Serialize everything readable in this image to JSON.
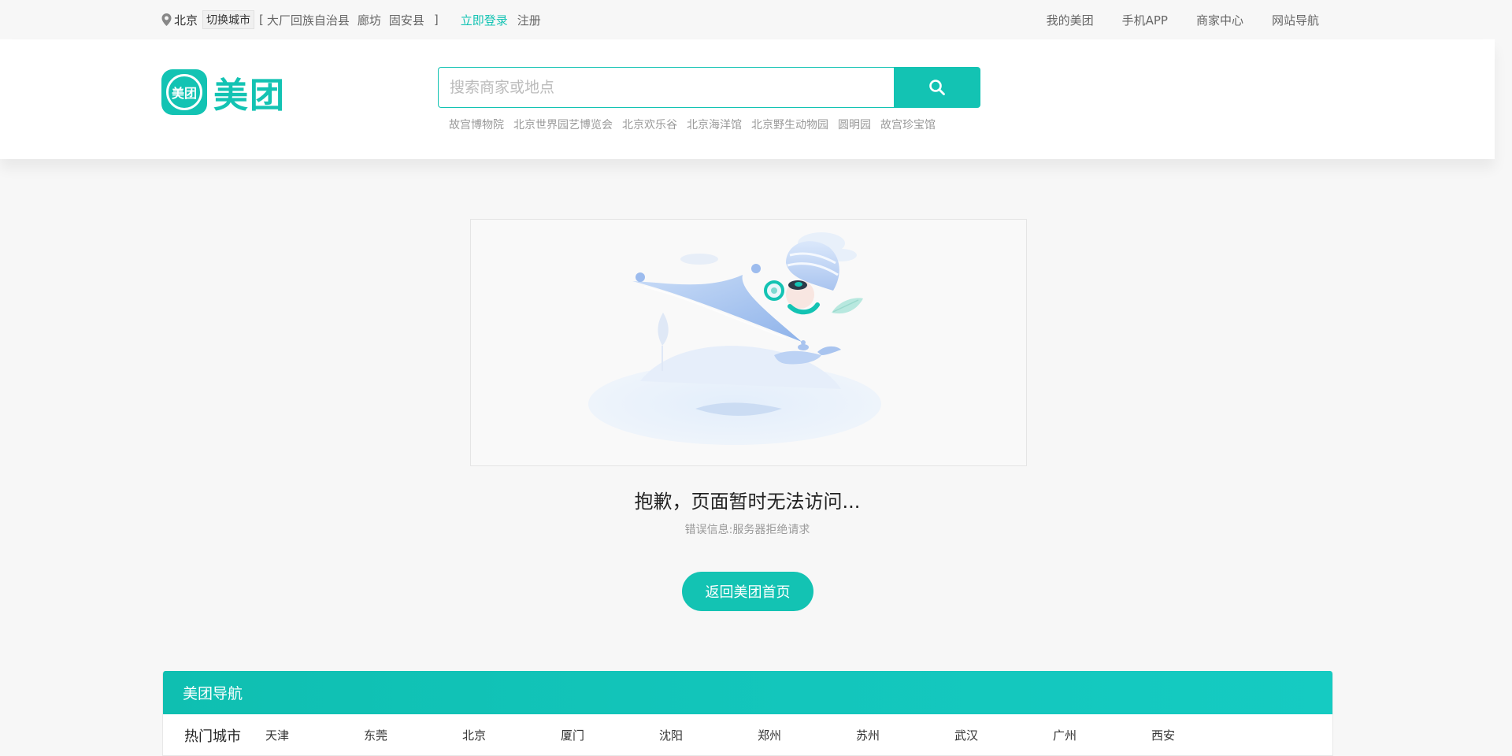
{
  "topbar": {
    "current_city": "北京",
    "switch_city_label": "切换城市",
    "nearby_open": "[",
    "nearby_cities": [
      "大厂回族自治县",
      "廊坊",
      "固安县"
    ],
    "nearby_close": "]",
    "login_label": "立即登录",
    "register_label": "注册",
    "right_links": [
      "我的美团",
      "手机APP",
      "商家中心",
      "网站导航"
    ]
  },
  "header": {
    "logo_badge_text": "美团",
    "logo_text": "美团",
    "search_placeholder": "搜索商家或地点",
    "search_icon": "search-icon",
    "hot_words": [
      "故宫博物院",
      "北京世界园艺博览会",
      "北京欢乐谷",
      "北京海洋馆",
      "北京野生动物园",
      "圆明园",
      "故宫珍宝馆"
    ]
  },
  "error": {
    "title": "抱歉，页面暂时无法访问...",
    "message": "错误信息:服务器拒绝请求",
    "back_home_label": "返回美团首页"
  },
  "nav": {
    "title": "美团导航",
    "hot_cities_label": "热门城市",
    "hot_cities": [
      "天津",
      "东莞",
      "北京",
      "厦门",
      "沈阳",
      "郑州",
      "苏州",
      "武汉",
      "广州",
      "西安"
    ]
  },
  "colors": {
    "brand": "#13c3b3",
    "background": "#f7f7f7",
    "text_muted": "#999999"
  }
}
